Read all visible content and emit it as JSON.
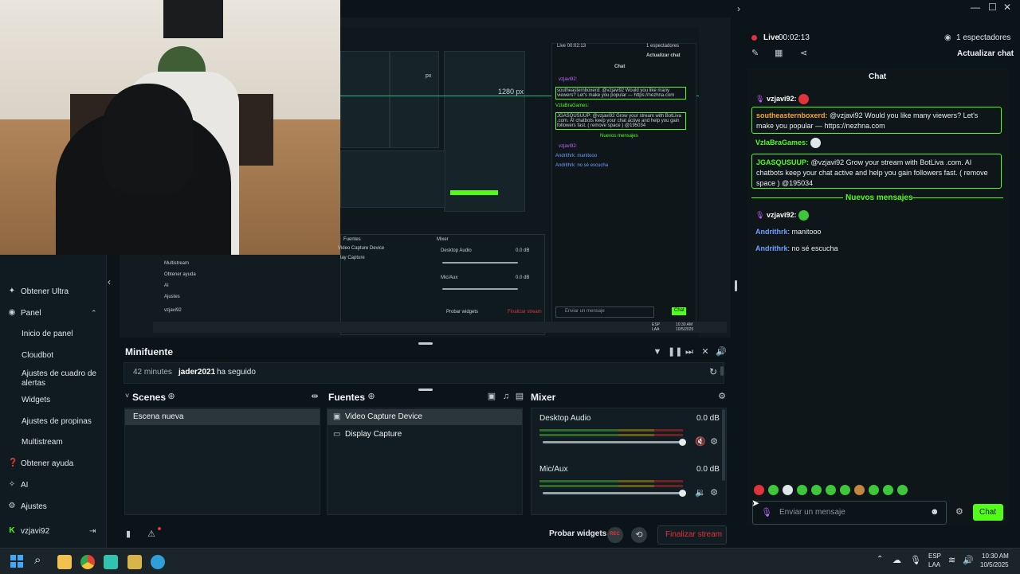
{
  "window_controls": {
    "minimize": "—",
    "maximize": "☐",
    "close": "✕"
  },
  "preview": {
    "mini_chat_title": "Chat",
    "mini_live": "Live 00:02:13",
    "mini_viewers": "1 espectadores",
    "mini_refresh": "Actualizar chat",
    "mini_new_messages": "Nuevos mensajes",
    "mini_send_placeholder": "Enviar un mensaje",
    "mini_chat_btn": "Chat",
    "mini_px_label": "1280 px",
    "mini_px_label2": "px",
    "mini_fuentes": "Fuentes",
    "mini_mixer": "Mixer",
    "mini_video": "Video Capture Device",
    "mini_display": "Display Capture",
    "mini_desktop": "Desktop Audio",
    "mini_mic": "Mic/Aux",
    "mini_db": "0.0 dB",
    "mini_probar": "Probar widgets",
    "mini_finalizar": "Finalizar stream",
    "mini_multistream": "Multistream",
    "mini_ayuda": "Obtener ayuda",
    "mini_ai": "AI",
    "mini_ajustes": "Ajustes",
    "mini_user": "vzjavi92",
    "mini_esp": "ESP",
    "mini_laa": "LAA",
    "mini_time": "10:30 AM",
    "mini_date": "10/5/2025",
    "mini_msg1_user": "vzjavi92:",
    "mini_msg2": "southeasternboxerd: @vzjavi92 Would you like many viewers? Let's make you popular — https://nezhna.com",
    "mini_msg3": "VzlaBraGames:",
    "mini_msg4": "JGASQUSUUP: @vzjavi92 Grow your stream with BotLiva .com. AI chatbots keep your chat active and help you gain followers fast. ( remove space ) @195034",
    "mini_msg5": "Andrithrk: manitooo",
    "mini_msg6": "Andrithrk: no sé escucha"
  },
  "sidebar": {
    "items": [
      {
        "label": "Obtener Ultra",
        "icon": "ultra-icon"
      },
      {
        "label": "Panel",
        "icon": "panel-icon"
      }
    ],
    "sub_items": [
      "Inicio de panel",
      "Cloudbot",
      "Ajustes de cuadro de alertas",
      "Widgets",
      "Ajustes de propinas",
      "Multistream"
    ],
    "bottom_items": [
      {
        "label": "Obtener ayuda",
        "icon": "help-icon"
      },
      {
        "label": "AI",
        "icon": "ai-icon"
      },
      {
        "label": "Ajustes",
        "icon": "gear-icon"
      }
    ],
    "user": "vzjavi92"
  },
  "minifeed": {
    "title": "Minifuente",
    "event_time": "42 minutes",
    "event_user": "jader2021",
    "event_action": "ha seguido"
  },
  "scenes": {
    "title": "Scenes",
    "items": [
      "Escena nueva"
    ]
  },
  "sources": {
    "title": "Fuentes",
    "items": [
      "Video Capture Device",
      "Display Capture"
    ]
  },
  "mixer": {
    "title": "Mixer",
    "channels": [
      {
        "name": "Desktop Audio",
        "db": "0.0 dB",
        "level": 1.0
      },
      {
        "name": "Mic/Aux",
        "db": "0.0 dB",
        "level": 1.0
      }
    ]
  },
  "footer": {
    "test_widgets": "Probar widgets",
    "rec": "REC",
    "end_stream": "Finalizar stream"
  },
  "chat": {
    "live_label": "Live",
    "live_time": "00:02:13",
    "viewers": "1 espectadores",
    "refresh": "Actualizar chat",
    "title": "Chat",
    "messages": [
      {
        "user": "vzjavi92:",
        "text": ""
      },
      {
        "user": "southeasternboxerd:",
        "text": " @vzjavi92 Would you like many viewers? Let's make you popular — https://nezhna.com"
      },
      {
        "user": "VzlaBraGames:",
        "text": ""
      },
      {
        "user": "JGASQUSUUP:",
        "text": " @vzjavi92 Grow your stream with BotLiva .com. AI chatbots keep your chat active and help you gain followers fast. ( remove space ) @195034"
      },
      {
        "user": "vzjavi92:",
        "text": ""
      },
      {
        "user": "Andrithrk",
        "text": ": manitooo"
      },
      {
        "user": "Andrithrk",
        "text": ": no sé escucha"
      }
    ],
    "new_messages": "Nuevos mensajes",
    "input_placeholder": "Enviar un mensaje",
    "send_button": "Chat"
  },
  "taskbar": {
    "lang1": "ESP",
    "lang2": "LAA",
    "time": "10:30 AM",
    "date": "10/5/2025"
  },
  "colors": {
    "accent": "#53fc18",
    "rec": "#e0343a",
    "username_green": "#53fc18",
    "username_blue": "#6ea0ff",
    "username_orange": "#f5a623"
  }
}
